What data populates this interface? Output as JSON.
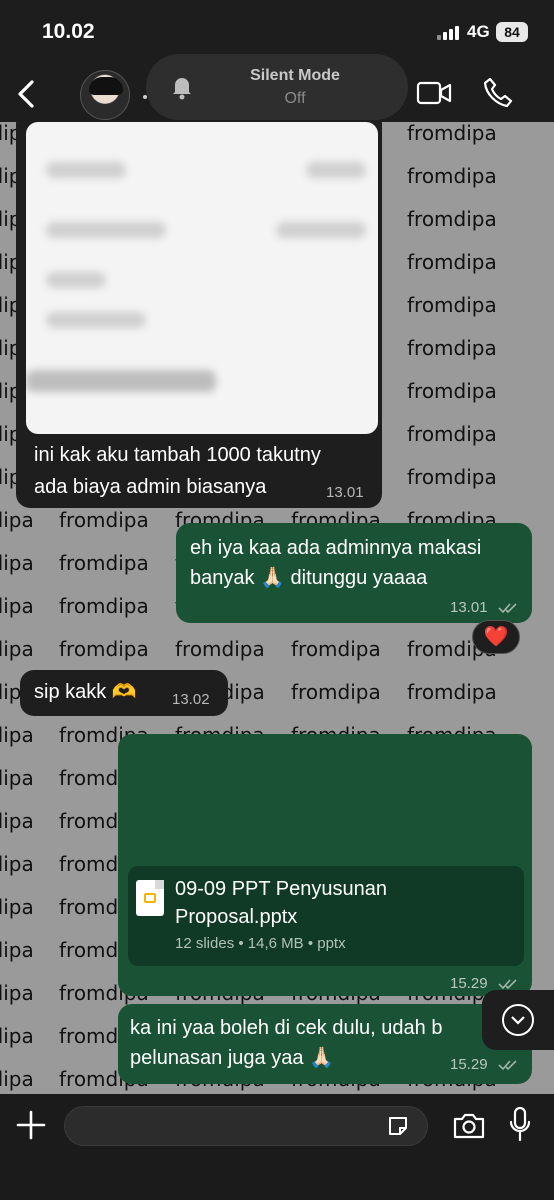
{
  "status_bar": {
    "time": "10.02",
    "network": "4G",
    "battery": "84"
  },
  "header": {
    "silent_title": "Silent Mode",
    "silent_state": "Off"
  },
  "watermark": "fromdipa",
  "messages": [
    {
      "id": "m1",
      "direction": "in",
      "text_line1": "ini kak aku tambah 1000 takutny",
      "text_line2": "ada biaya admin biasanya",
      "time": "13.01"
    },
    {
      "id": "m2",
      "direction": "out",
      "text_line1": "eh iya kaa ada adminnya makasi",
      "text_line2": "banyak 🙏🏻 ditunggu yaaaa",
      "time": "13.01",
      "reaction": "❤️"
    },
    {
      "id": "m3",
      "direction": "in",
      "text": "sip kakk 🫶",
      "time": "13.02"
    },
    {
      "id": "m4",
      "direction": "out",
      "file": {
        "name_line1": "09-09 PPT Penyusunan",
        "name_line2": "Proposal.pptx",
        "meta": "12 slides • 14,6 MB • pptx"
      },
      "time": "15.29"
    },
    {
      "id": "m5",
      "direction": "out",
      "text_line1": "ka ini yaa boleh di cek dulu, udah b",
      "text_line2": "pelunasan juga yaa 🙏🏻",
      "time": "15.29"
    }
  ],
  "colors": {
    "outgoing_bubble": "#1a5235",
    "incoming_bubble": "#1e1e1e",
    "header_bg": "#1d1d1d",
    "chat_bg": "#9a9a9a"
  },
  "icons": [
    "back-icon",
    "bell-icon",
    "video-call-icon",
    "phone-call-icon",
    "plus-icon",
    "sticker-icon",
    "camera-icon",
    "mic-icon",
    "double-check-icon",
    "chevron-down-icon",
    "file-pptx-icon"
  ]
}
